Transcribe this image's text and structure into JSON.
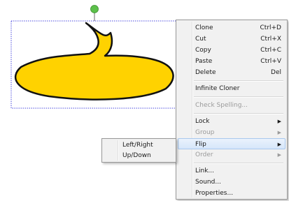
{
  "context_menu": {
    "items": [
      {
        "label": "Clone",
        "shortcut": "Ctrl+D"
      },
      {
        "label": "Cut",
        "shortcut": "Ctrl+X"
      },
      {
        "label": "Copy",
        "shortcut": "Ctrl+C"
      },
      {
        "label": "Paste",
        "shortcut": "Ctrl+V"
      },
      {
        "label": "Delete",
        "shortcut": "Del"
      },
      {
        "label": "Infinite Cloner"
      },
      {
        "label": "Check Spelling..."
      },
      {
        "label": "Lock"
      },
      {
        "label": "Group"
      },
      {
        "label": "Flip"
      },
      {
        "label": "Order"
      },
      {
        "label": "Link..."
      },
      {
        "label": "Sound..."
      },
      {
        "label": "Properties..."
      }
    ]
  },
  "flip_submenu": {
    "items": [
      {
        "label": "Left/Right"
      },
      {
        "label": "Up/Down"
      }
    ]
  },
  "colors": {
    "bubble_fill": "#ffd200",
    "bubble_stroke": "#111111",
    "selection_border": "#4a4adf",
    "rotate_handle": "#5cc04a"
  }
}
